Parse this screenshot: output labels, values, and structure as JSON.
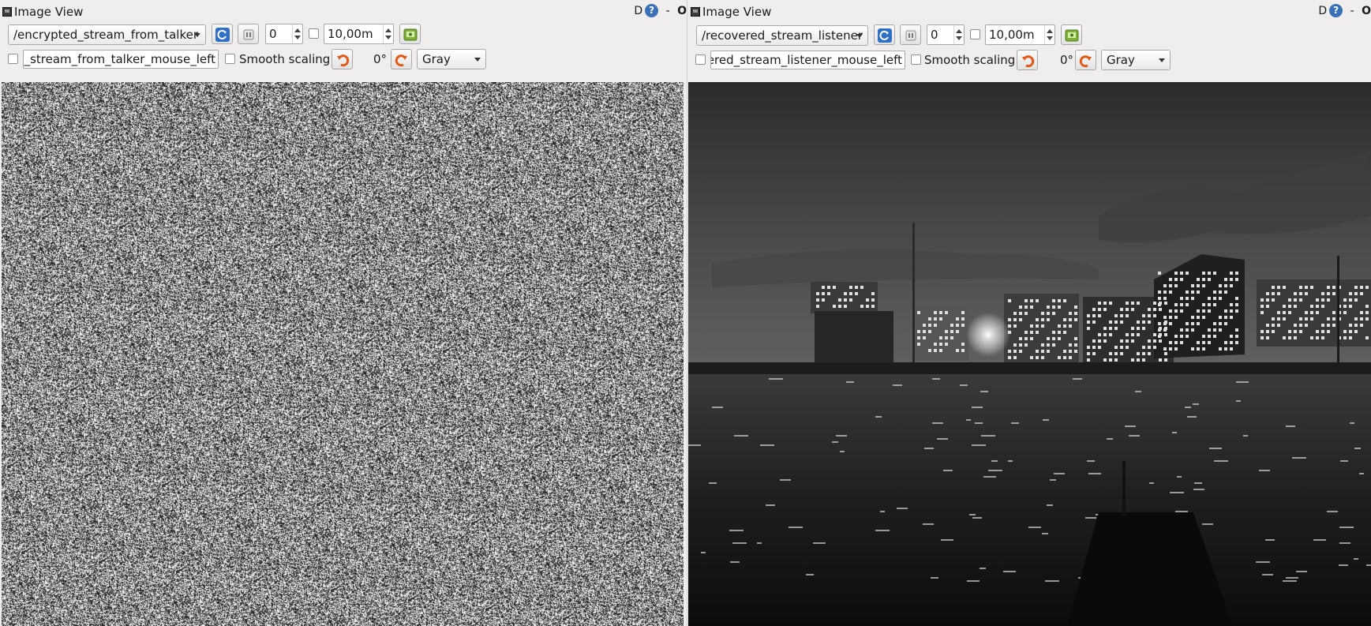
{
  "left": {
    "window_title": "Image View",
    "title_d": "D",
    "title_help": "?",
    "title_min": "-",
    "title_o": "O",
    "topic": "/encrypted_stream_from_talker",
    "spin_value": "0",
    "ms_value": "10,00m",
    "mouse_topic": "ed_stream_from_talker_mouse_left",
    "smooth_label": "Smooth scaling",
    "rotation": "0°",
    "colormap": "Gray",
    "image": "random-noise"
  },
  "right": {
    "window_title": "Image View",
    "title_d": "D",
    "title_help": "?",
    "title_min": "-",
    "title_o": "O",
    "topic": "/recovered_stream_listener",
    "spin_value": "0",
    "ms_value": "10,00m",
    "mouse_topic": "overed_stream_listener_mouse_left",
    "smooth_label": "Smooth scaling",
    "rotation": "0°",
    "colormap": "Gray",
    "image": "harbor-night-grayscale"
  },
  "icons": {
    "refresh": "refresh-icon",
    "pause": "pause-icon",
    "save": "save-image-icon",
    "rotate_left": "rotate-left-icon",
    "rotate_right": "rotate-right-icon"
  }
}
